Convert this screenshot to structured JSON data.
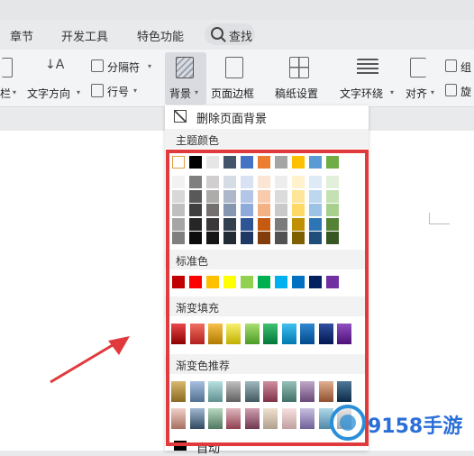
{
  "tabs": [
    "章节",
    "开发工具",
    "特色功能"
  ],
  "search_label": "查找",
  "ribbon": {
    "col_label": "栏",
    "text_direction": "文字方向",
    "separator": "分隔符",
    "line_number": "行号",
    "background": "背景",
    "page_border": "页面边框",
    "paper_setup": "稿纸设置",
    "text_wrap": "文字环绕",
    "align": "对齐",
    "group_partial": "组",
    "rotate_partial": "旋"
  },
  "menu": {
    "remove_background": "删除页面背景",
    "theme_colors": "主题颜色",
    "standard_colors": "标准色",
    "gradient_fill": "渐变填充",
    "gradient_recommended": "渐变色推荐",
    "auto": "自动"
  },
  "colors": {
    "highlight_box": "#e03a3c",
    "theme_top": [
      "#ffffff",
      "#000000",
      "#e7e6e6",
      "#44546a",
      "#4472c4",
      "#ed7d31",
      "#a5a5a5",
      "#ffc000",
      "#5b9bd5",
      "#70ad47"
    ],
    "theme_shades": [
      [
        "#f2f2f2",
        "#7f7f7f",
        "#d0cece",
        "#d6dce4",
        "#d9e2f3",
        "#fbe5d5",
        "#ededed",
        "#fff2cc",
        "#deebf6",
        "#e2efd9"
      ],
      [
        "#d8d8d8",
        "#595959",
        "#aeabab",
        "#adb9ca",
        "#b4c6e7",
        "#f7cbac",
        "#dbdbdb",
        "#fee599",
        "#bdd7ee",
        "#c5e0b3"
      ],
      [
        "#bfbfbf",
        "#3f3f3f",
        "#757070",
        "#8496b0",
        "#8eaadb",
        "#f4b183",
        "#c9c9c9",
        "#ffd965",
        "#9cc3e5",
        "#a8d08d"
      ],
      [
        "#a5a5a5",
        "#262626",
        "#3a3838",
        "#323f4f",
        "#2f5496",
        "#c55a11",
        "#7b7b7b",
        "#bf9000",
        "#2e75b5",
        "#538135"
      ],
      [
        "#7f7f7f",
        "#0c0c0c",
        "#171616",
        "#222a35",
        "#1f3864",
        "#833c0b",
        "#525252",
        "#7f6000",
        "#1e4e79",
        "#375623"
      ]
    ],
    "standard": [
      "#c00000",
      "#ff0000",
      "#ffc000",
      "#ffff00",
      "#92d050",
      "#00b050",
      "#00b0f0",
      "#0070c0",
      "#002060",
      "#7030a0"
    ],
    "gradient_fill": [
      [
        "#e8484a",
        "#8c0000"
      ],
      [
        "#f07060",
        "#b02020"
      ],
      [
        "#f8c048",
        "#b07a00"
      ],
      [
        "#f8f070",
        "#c0b000"
      ],
      [
        "#a8e070",
        "#4c9a28"
      ],
      [
        "#40c070",
        "#00783a"
      ],
      [
        "#40c0f0",
        "#0078b0"
      ],
      [
        "#3088d0",
        "#004a8c"
      ],
      [
        "#3050a0",
        "#001850"
      ],
      [
        "#9050c0",
        "#4c1078"
      ]
    ],
    "gradient_recommended": [
      [
        [
          "#d8b870",
          "#8a6a20"
        ],
        [
          "#a8c0e0",
          "#507090"
        ],
        [
          "#b8e0e0",
          "#609090"
        ],
        [
          "#c0c0c0",
          "#606060"
        ],
        [
          "#a0b8c0",
          "#405860"
        ],
        [
          "#d090a0",
          "#803048"
        ],
        [
          "#98c0b8",
          "#407068"
        ],
        [
          "#c0a8c8",
          "#684878"
        ],
        [
          "#e0b090",
          "#905030"
        ],
        [
          "#507898",
          "#0a2a48"
        ]
      ],
      [
        [
          "#f0d0c8",
          "#a87060"
        ],
        [
          "#a0b8d0",
          "#304860"
        ],
        [
          "#b8d8c0",
          "#507860"
        ],
        [
          "#e0b8c0",
          "#904050"
        ],
        [
          "#d0a0b0",
          "#703850"
        ],
        [
          "#f0e0d0",
          "#b0a090"
        ],
        [
          "#f8e0e0",
          "#c0a0a0"
        ],
        [
          "#c8c0e0",
          "#706098"
        ],
        [
          "#b0d8e8",
          "#5088a8"
        ],
        [
          "#e8e8e8",
          "#a8a8a8"
        ]
      ]
    ]
  }
}
